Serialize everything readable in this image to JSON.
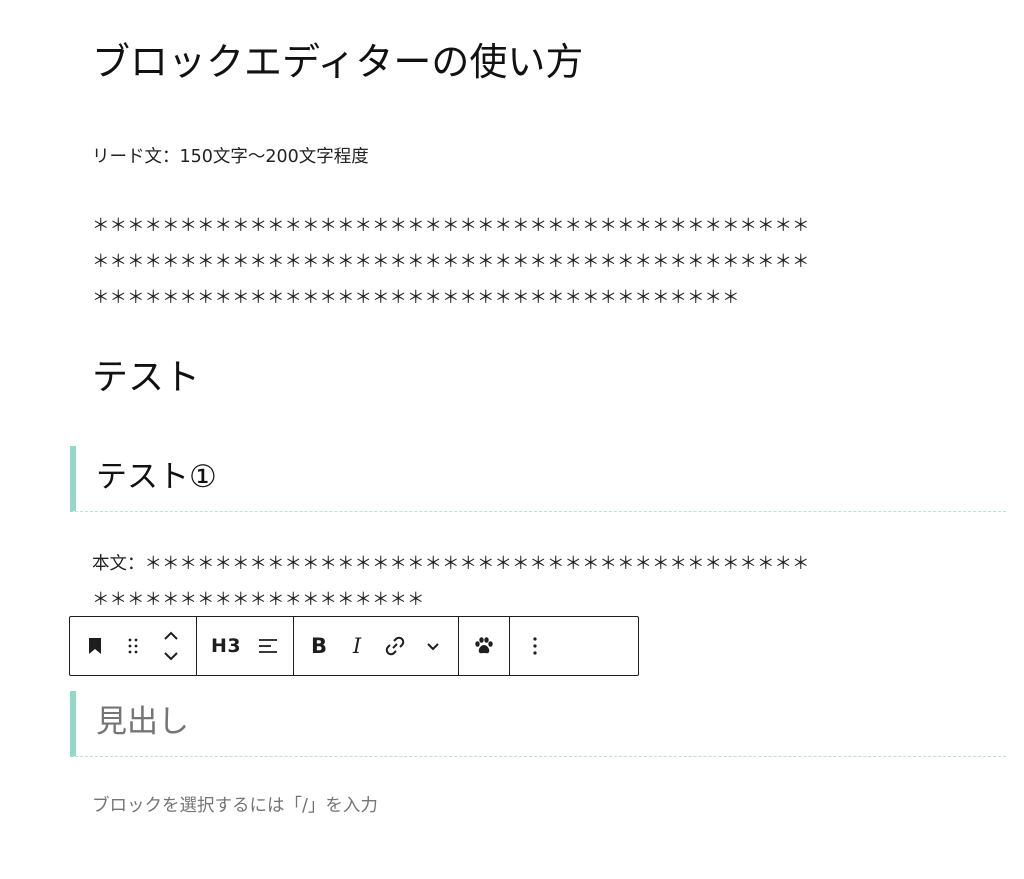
{
  "editor": {
    "post_title": "ブロックエディターの使い方",
    "lead_text": "リード文：150文字〜200文字程度",
    "asterisk_lines": [
      "＊＊＊＊＊＊＊＊＊＊＊＊＊＊＊＊＊＊＊＊＊＊＊＊＊＊＊＊＊＊＊＊＊＊＊＊＊＊＊＊＊",
      "＊＊＊＊＊＊＊＊＊＊＊＊＊＊＊＊＊＊＊＊＊＊＊＊＊＊＊＊＊＊＊＊＊＊＊＊＊＊＊＊＊",
      "＊＊＊＊＊＊＊＊＊＊＊＊＊＊＊＊＊＊＊＊＊＊＊＊＊＊＊＊＊＊＊＊＊＊＊＊＊"
    ],
    "heading_h2": "テスト",
    "heading_h3_1": "テスト①",
    "body_line_1": "本文：＊＊＊＊＊＊＊＊＊＊＊＊＊＊＊＊＊＊＊＊＊＊＊＊＊＊＊＊＊＊＊＊＊＊＊＊＊＊",
    "body_line_2": "＊＊＊＊＊＊＊＊＊＊＊＊＊＊＊＊＊＊＊",
    "heading_h3_placeholder": "見出し",
    "append_hint": "ブロックを選択するには「/」を入力"
  },
  "toolbar": {
    "heading_level_label": "H3",
    "bold_label": "B",
    "italic_label": "I",
    "icons": {
      "block_type": "bookmark-icon",
      "drag": "drag-handle-icon",
      "move": "move-up-down-icon",
      "align": "align-left-icon",
      "link": "link-icon",
      "more_rich_text": "chevron-down-icon",
      "plugin": "paw-icon",
      "options": "vertical-ellipsis-icon"
    }
  },
  "colors": {
    "heading_accent": "#93d8c9",
    "text": "#1e1e1e",
    "placeholder": "#757575"
  }
}
